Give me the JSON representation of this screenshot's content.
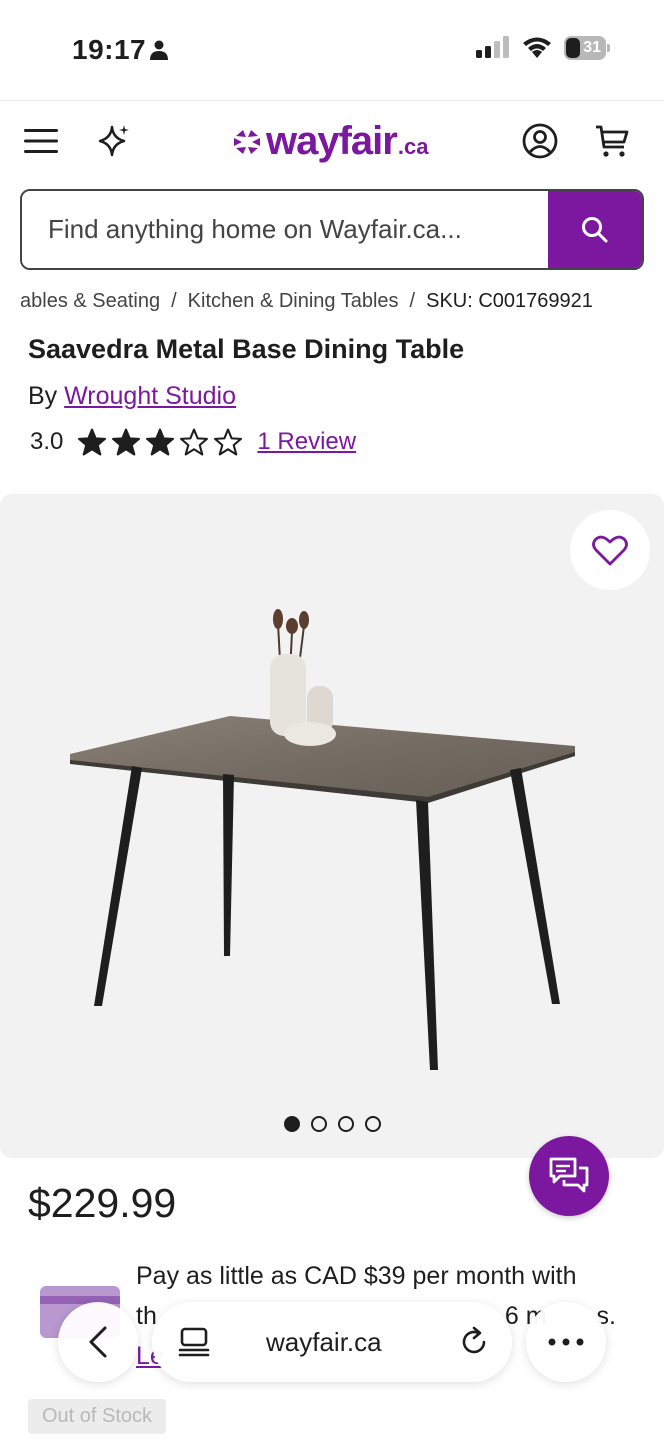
{
  "status_bar": {
    "time": "19:17",
    "battery": "31"
  },
  "header": {
    "logo_word": "wayfair",
    "logo_tld": ".ca",
    "brand_color": "#7b189f",
    "icons": [
      "menu-icon",
      "sparkle-icon",
      "account-icon",
      "cart-icon"
    ]
  },
  "search": {
    "placeholder": "Find anything home on Wayfair.ca..."
  },
  "breadcrumb": {
    "items": [
      "ables & Seating",
      "Kitchen & Dining Tables"
    ],
    "separator": "/",
    "current": "SKU: C001769921"
  },
  "product": {
    "title": "Saavedra Metal Base Dining Table",
    "by_prefix": "By",
    "brand": "Wrought Studio",
    "rating": "3.0",
    "rating_stars": 3,
    "rating_max": 5,
    "review_link": "1 Review",
    "price": "$229.99",
    "image_count": 4,
    "active_image": 0
  },
  "financing": {
    "line1": "Pay as little as CAD $39 per month with",
    "line2_start": "th",
    "line2_end": "6 m",
    "line2_tail": "s.",
    "link_start": "Le"
  },
  "stock": {
    "label": "Out of Stock"
  },
  "browser_bar": {
    "url": "wayfair.ca",
    "icons": [
      "back-icon",
      "tabs-icon",
      "reload-icon",
      "more-icon"
    ]
  }
}
